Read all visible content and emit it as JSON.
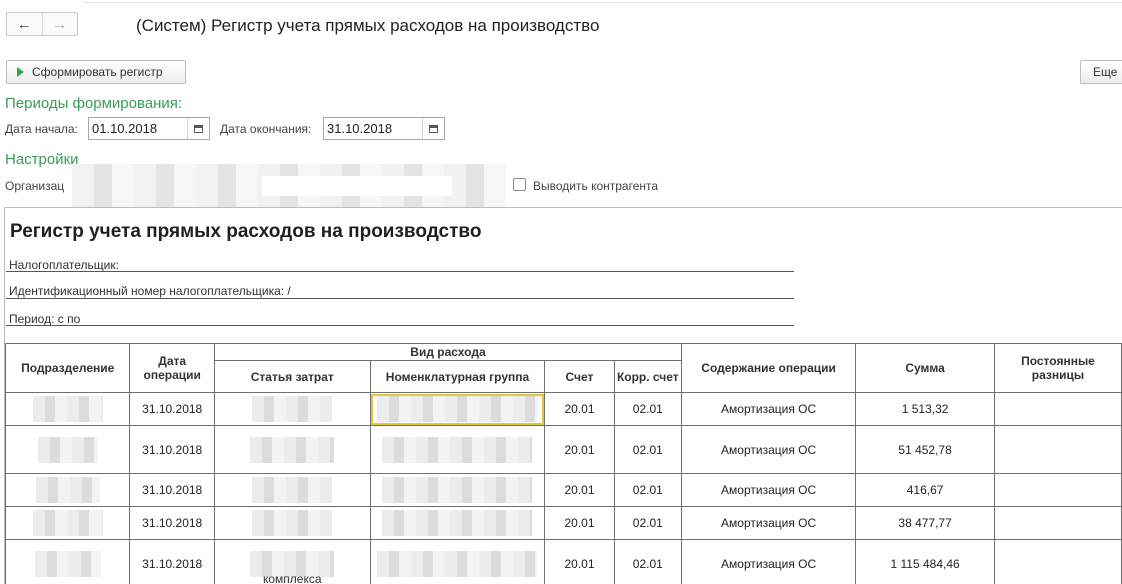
{
  "window": {
    "title": "(Систем) Регистр учета прямых расходов на производство",
    "back_glyph": "←",
    "forward_glyph": "→"
  },
  "toolbar": {
    "form_button": "Сформировать регистр",
    "more_button": "Еще"
  },
  "periods": {
    "section_title": "Периоды формирования:",
    "start_label": "Дата начала:",
    "start_value": "01.10.2018",
    "end_label": "Дата окончания:",
    "end_value": "31.10.2018"
  },
  "settings": {
    "section_title": "Настройки",
    "org_label": "Организац",
    "show_counterparty_label": "Выводить контрагента",
    "show_counterparty_checked": false
  },
  "report": {
    "title": "Регистр учета прямых расходов на производство",
    "taxpayer_label": "Налогоплательщик:",
    "inn_label": "Идентификационный номер налогоплательщика: /",
    "period_label": "Период: с  по",
    "headers": {
      "department": "Подразделение",
      "date": "Дата операции",
      "expense_type": "Вид расхода",
      "cost_item": "Статья затрат",
      "nomenclature_group": "Номенклатурная группа",
      "account": "Счет",
      "corr_account": "Корр. счет",
      "operation": "Содержание операции",
      "amount": "Сумма",
      "permanent_diff": "Постоянные разницы"
    },
    "rows": [
      {
        "date": "31.10.2018",
        "account": "20.01",
        "corr": "02.01",
        "operation": "Амортизация ОС",
        "amount": "1 513,32"
      },
      {
        "date": "31.10.2018",
        "account": "20.01",
        "corr": "02.01",
        "operation": "Амортизация ОС",
        "amount": "51 452,78"
      },
      {
        "date": "31.10.2018",
        "account": "20.01",
        "corr": "02.01",
        "operation": "Амортизация ОС",
        "amount": "416,67"
      },
      {
        "date": "31.10.2018",
        "account": "20.01",
        "corr": "02.01",
        "operation": "Амортизация ОС",
        "amount": "38 477,77"
      },
      {
        "date": "31.10.2018",
        "account": "20.01",
        "corr": "02.01",
        "operation": "Амортизация ОС",
        "amount": "1 115 484,46"
      }
    ],
    "tail_text": "комплекса"
  },
  "colors": {
    "section_green": "#3c9a5f",
    "play_green": "#2ea84a",
    "selection_yellow": "#e6c73a"
  }
}
